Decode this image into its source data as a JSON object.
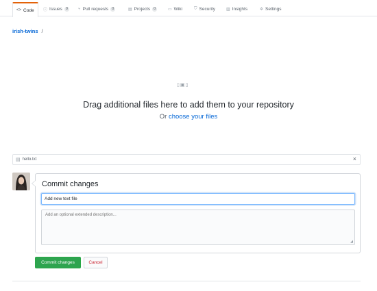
{
  "tabs": [
    {
      "label": "Code",
      "icon": "code-icon",
      "selected": true
    },
    {
      "label": "Issues",
      "icon": "issue-icon",
      "count": "0"
    },
    {
      "label": "Pull requests",
      "icon": "pull-request-icon",
      "count": "0"
    },
    {
      "label": "Projects",
      "icon": "project-icon",
      "count": "0"
    },
    {
      "label": "Wiki",
      "icon": "book-icon"
    },
    {
      "label": "Security",
      "icon": "shield-icon"
    },
    {
      "label": "Insights",
      "icon": "graph-icon"
    },
    {
      "label": "Settings",
      "icon": "gear-icon"
    }
  ],
  "breadcrumb": {
    "repo": "irish-twins",
    "separator": "/"
  },
  "dropzone": {
    "icon": "file-stack-icon",
    "title": "Drag additional files here to add them to your repository",
    "sub_prefix": "Or",
    "sub_link": "choose your files"
  },
  "file": {
    "name": "hello.txt",
    "close": "×"
  },
  "commit": {
    "title": "Commit changes",
    "summary_value": "Add new text file",
    "description_placeholder": "Add an optional extended description...",
    "commit_button": "Commit changes",
    "cancel_button": "Cancel"
  },
  "colors": {
    "accent_tab": "#e36209",
    "link": "#0366d6",
    "commit_button": "#2ea44f",
    "cancel_text": "#cb2431"
  }
}
